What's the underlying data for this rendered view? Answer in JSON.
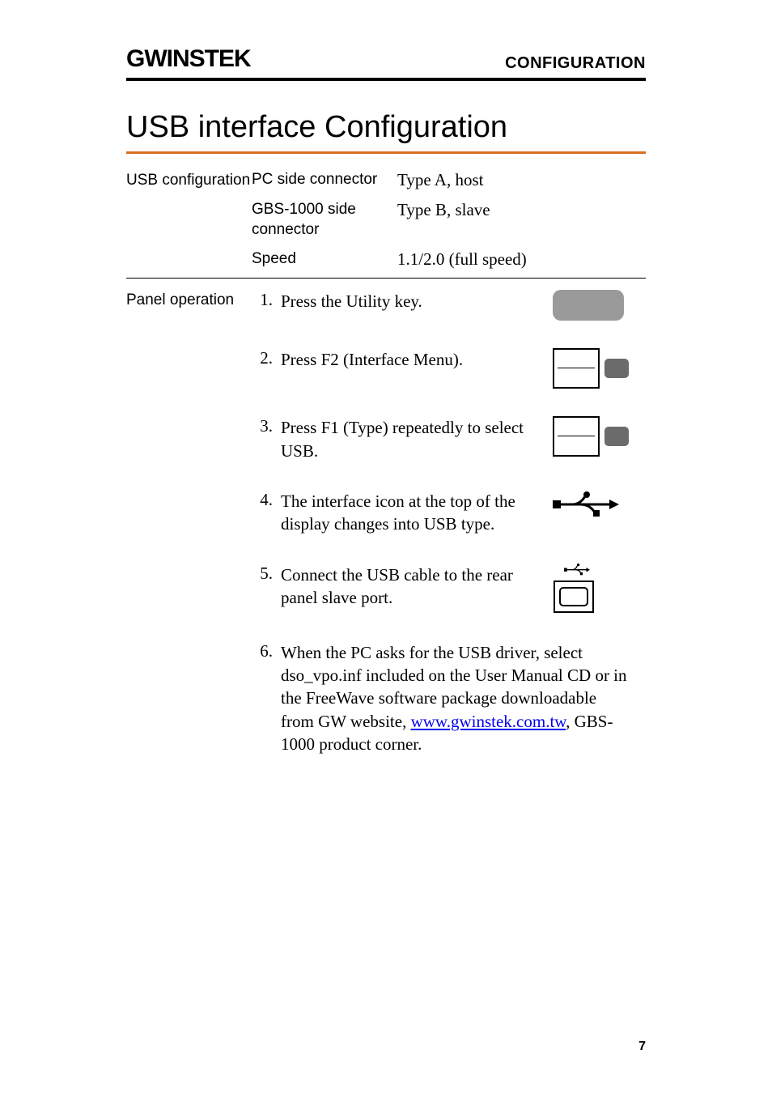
{
  "header": {
    "brand": "GWINSTEK",
    "section_label": "CONFIGURATION"
  },
  "page_title": "USB interface Configuration",
  "usb_config": {
    "side_label": "USB configuration",
    "rows": [
      {
        "label": "PC side connector",
        "value": "Type A, host"
      },
      {
        "label": "GBS-1000 side connector",
        "value": "Type B, slave"
      },
      {
        "label": "Speed",
        "value": "1.1/2.0 (full speed)"
      }
    ]
  },
  "panel_op": {
    "side_label": "Panel operation",
    "steps": [
      {
        "n": "1.",
        "text": "Press the Utility key.",
        "icon": "key"
      },
      {
        "n": "2.",
        "text": "Press F2 (Interface Menu).",
        "icon": "screenkey"
      },
      {
        "n": "3.",
        "text": "Press F1 (Type) repeatedly to select USB.",
        "icon": "screenkey"
      },
      {
        "n": "4.",
        "text": "The interface icon at the top of the display changes into USB type.",
        "icon": "usbglyph"
      },
      {
        "n": "5.",
        "text": "Connect the USB cable to the rear panel slave port.",
        "icon": "usbport"
      },
      {
        "n": "6.",
        "text_pre": "When the PC asks for the USB driver, select dso_vpo.inf included on the User Manual CD or in the FreeWave software package downloadable from GW website, ",
        "link_text": "www.gwinstek.com.tw",
        "text_post": ", GBS-1000 product corner.",
        "icon": "none"
      }
    ]
  },
  "page_number": "7"
}
